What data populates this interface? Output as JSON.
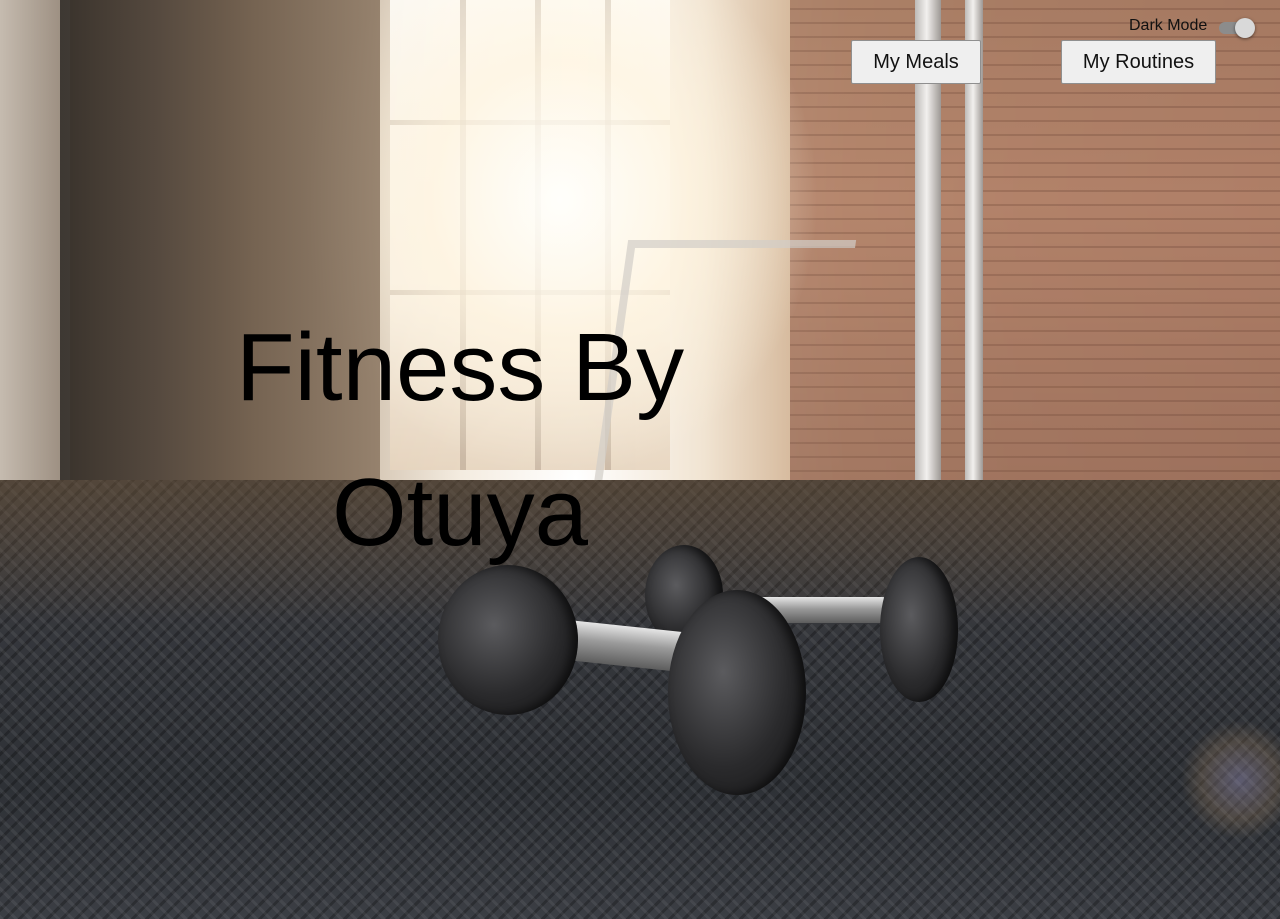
{
  "header": {
    "dark_mode_label": "Dark Mode",
    "dark_mode_on": true
  },
  "nav": {
    "meals_label": "My Meals",
    "routines_label": "My Routines"
  },
  "hero": {
    "title_line1": "Fitness By",
    "title_line2": "Otuya",
    "background_image": "gym-dumbbells-photo"
  }
}
